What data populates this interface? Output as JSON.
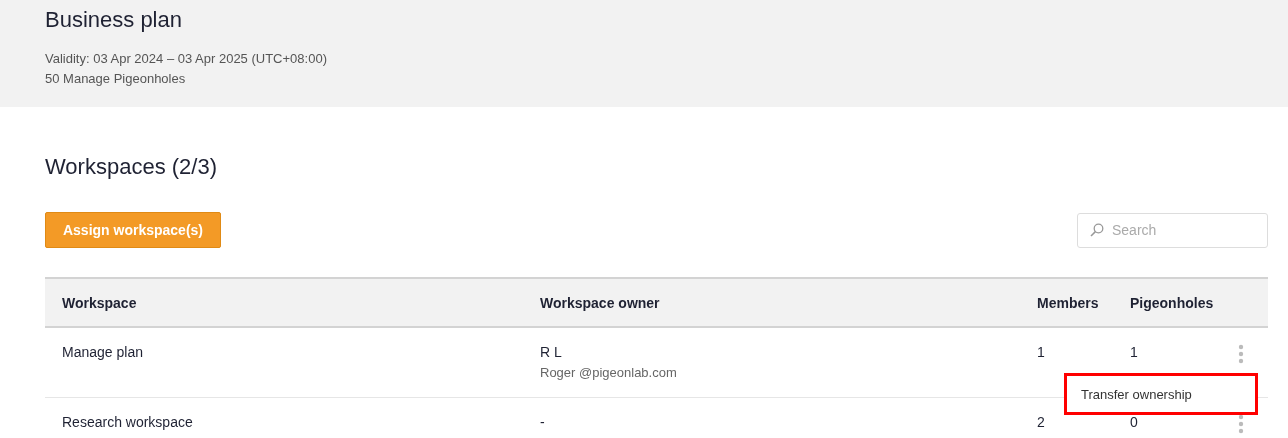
{
  "plan": {
    "title": "Business plan",
    "validity": "Validity: 03 Apr 2024 – 03 Apr 2025 (UTC+08:00)",
    "quota": "50 Manage Pigeonholes"
  },
  "workspaces": {
    "heading": "Workspaces (2/3)",
    "assign_button": "Assign workspace(s)",
    "search": {
      "placeholder": "Search"
    },
    "table": {
      "columns": [
        "Workspace",
        "Workspace owner",
        "Members",
        "Pigeonholes"
      ],
      "rows": [
        {
          "workspace": "Manage plan",
          "owner": "R L",
          "owner_email": "Roger @pigeonlab.com",
          "members": "1",
          "pigeonholes": "1",
          "menu_open": true
        },
        {
          "workspace": "Research workspace",
          "owner": "-",
          "members": "2",
          "pigeonholes": "0",
          "menu_open": false
        }
      ]
    },
    "row_menu": {
      "items": [
        "Transfer ownership"
      ]
    }
  }
}
